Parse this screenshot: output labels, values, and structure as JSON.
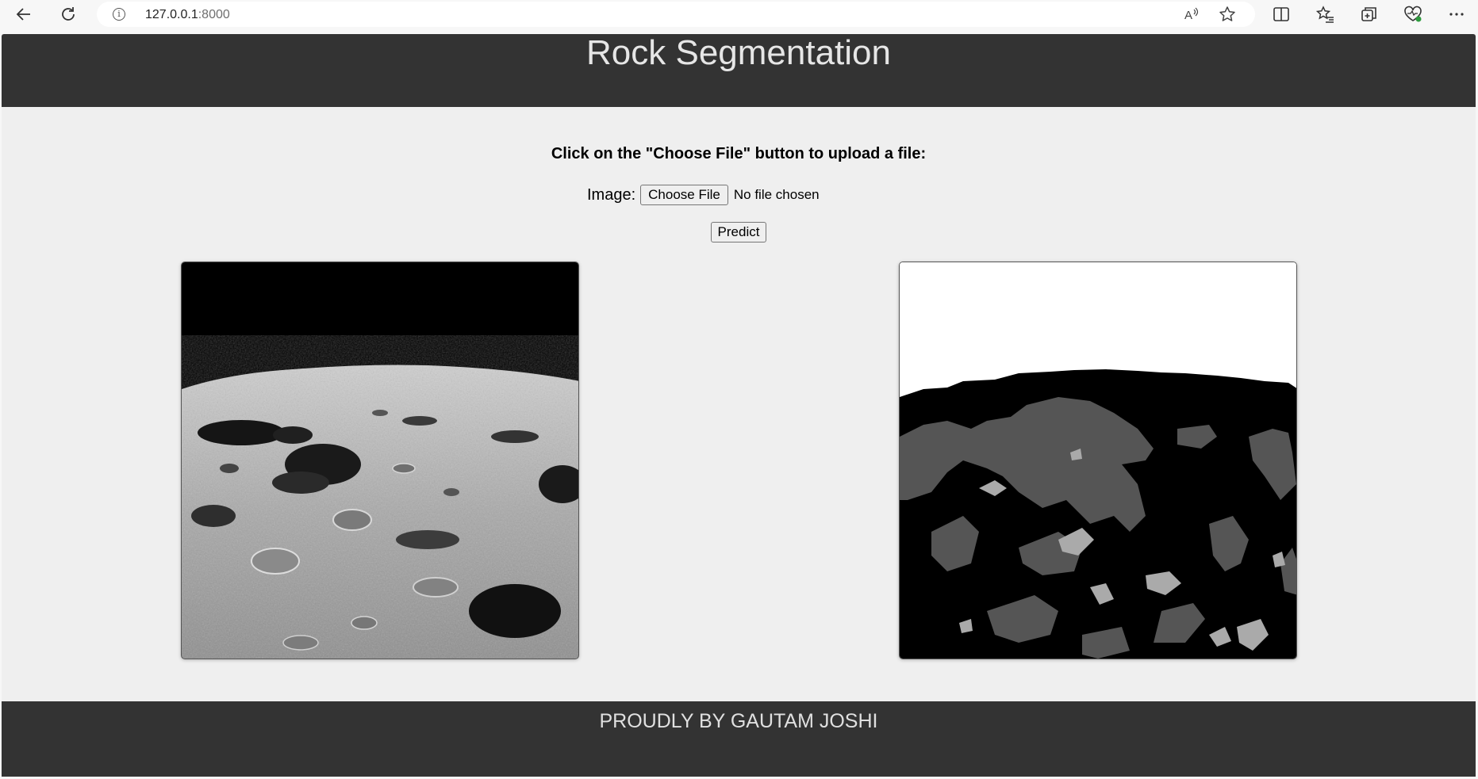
{
  "browser": {
    "url_host": "127.0.0.1",
    "url_port": ":8000",
    "icons": [
      "back-arrow-icon",
      "refresh-icon",
      "info-icon",
      "read-aloud-icon",
      "favorite-star-icon",
      "split-screen-icon",
      "favorites-icon",
      "collections-icon",
      "browser-essentials-icon",
      "more-menu-icon"
    ]
  },
  "header": {
    "title": "Rock Segmentation"
  },
  "form": {
    "instructions": "Click on the \"Choose File\" button to upload a file:",
    "image_label": "Image:",
    "choose_label": "Choose File",
    "no_file_text": "No file chosen",
    "predict_label": "Predict"
  },
  "images": {
    "original": "lunar-surface-photo",
    "segmented": "segmentation-mask"
  },
  "colors": {
    "header_bg": "#333333",
    "page_bg": "#efefef",
    "mask_sky": "#ffffff",
    "mask_ground": "#000000",
    "mask_small_rock": "#555555",
    "mask_large_rock": "#aaaaaa"
  },
  "footer": {
    "text": "PROUDLY BY GAUTAM JOSHI"
  }
}
